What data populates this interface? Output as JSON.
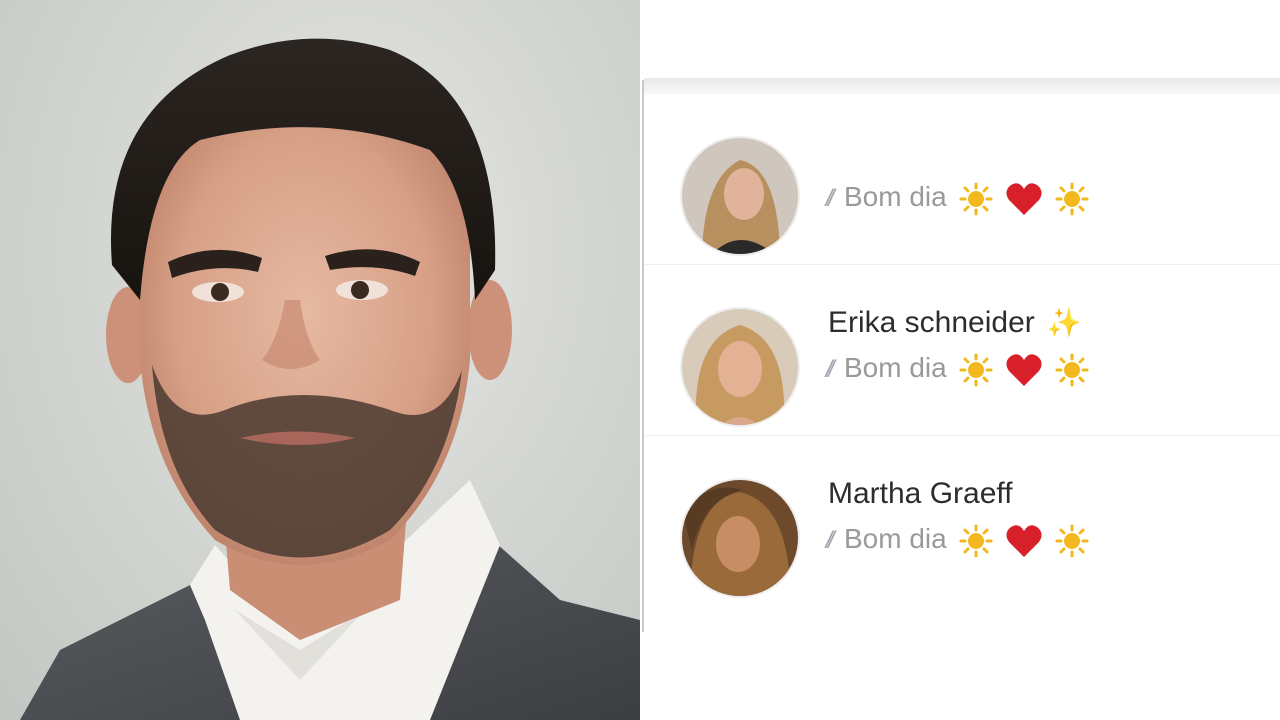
{
  "chat_list": {
    "rows": [
      {
        "name": "",
        "message": "Bom dia",
        "read_status": "delivered-read-double-check",
        "emojis": [
          "sun-emoji",
          "red-heart-emoji",
          "sun-emoji"
        ]
      },
      {
        "name": "Erika schneider",
        "name_suffix_icon": "sparkles-emoji",
        "message": "Bom dia",
        "read_status": "delivered-read-double-check",
        "emojis": [
          "sun-emoji",
          "red-heart-emoji",
          "sun-emoji"
        ]
      },
      {
        "name": "Martha Graeff",
        "message": "Bom dia",
        "read_status": "delivered-read-double-check",
        "emojis": [
          "sun-emoji",
          "red-heart-emoji",
          "sun-emoji"
        ]
      }
    ]
  },
  "colors": {
    "name_text": "#2d2d2d",
    "message_text": "#9a9a9a",
    "check_marks": "#9fa6ad",
    "heart": "#d8202b",
    "sun": "#f2b81e",
    "sparkle": "#f4c44a"
  }
}
